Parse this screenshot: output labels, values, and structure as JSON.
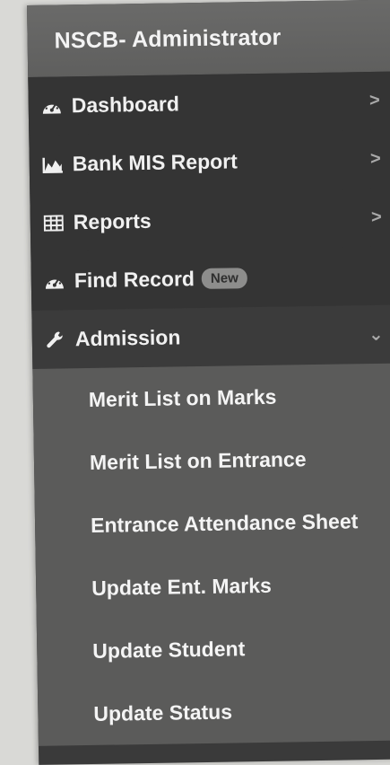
{
  "app": {
    "title": "NSCB- Administrator"
  },
  "menu": {
    "items": [
      {
        "label": "Dashboard",
        "icon": "dashboard-gauge-icon",
        "chevron": ">"
      },
      {
        "label": "Bank MIS Report",
        "icon": "area-chart-icon",
        "chevron": ">"
      },
      {
        "label": "Reports",
        "icon": "table-icon",
        "chevron": ">"
      },
      {
        "label": "Find Record",
        "icon": "dashboard-gauge-icon",
        "badge": "New"
      },
      {
        "label": "Admission",
        "icon": "wrench-icon",
        "chevron": "⌄"
      }
    ]
  },
  "admission": {
    "subitems": [
      {
        "label": "Merit List on Marks"
      },
      {
        "label": "Merit List on Entrance"
      },
      {
        "label": "Entrance Attendance Sheet"
      },
      {
        "label": "Update Ent. Marks"
      },
      {
        "label": "Update Student"
      },
      {
        "label": "Update Status"
      }
    ]
  },
  "colors": {
    "header_bg": "#626261",
    "menu_bg": "#343434",
    "submenu_bg": "#5b5b5a",
    "text": "#f0f0f0",
    "badge_bg": "#8d8d8c"
  }
}
